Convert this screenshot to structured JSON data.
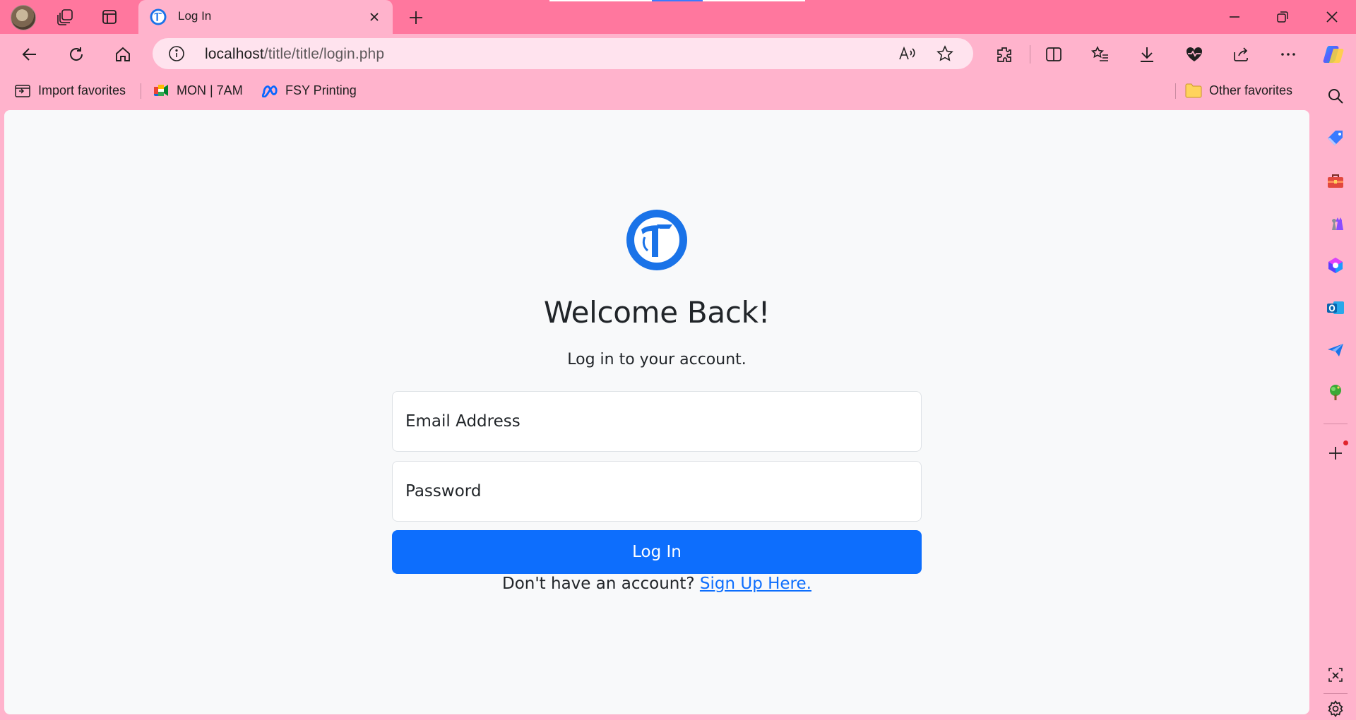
{
  "browser": {
    "tab": {
      "title": "Log In"
    },
    "address_bar": {
      "host": "localhost",
      "path": "/title/title/login.php"
    },
    "favorites": [
      {
        "label": "Import favorites",
        "icon": "import-favorites-icon"
      },
      {
        "label": "MON | 7AM",
        "icon": "google-meet-icon"
      },
      {
        "label": "FSY Printing",
        "icon": "meta-icon"
      }
    ],
    "other_favorites": "Other favorites"
  },
  "page": {
    "heading": "Welcome Back!",
    "subtitle": "Log in to your account.",
    "email": {
      "placeholder": "Email Address",
      "value": ""
    },
    "password": {
      "placeholder": "Password",
      "value": ""
    },
    "login_label": "Log In",
    "signup_prompt": "Don't have an account?",
    "signup_link": "Sign Up Here."
  },
  "colors": {
    "browser_frame": "#ff779e",
    "browser_toolbar": "#ffb3cc",
    "primary": "#0d6efd",
    "page_background": "#f8f9fa"
  }
}
